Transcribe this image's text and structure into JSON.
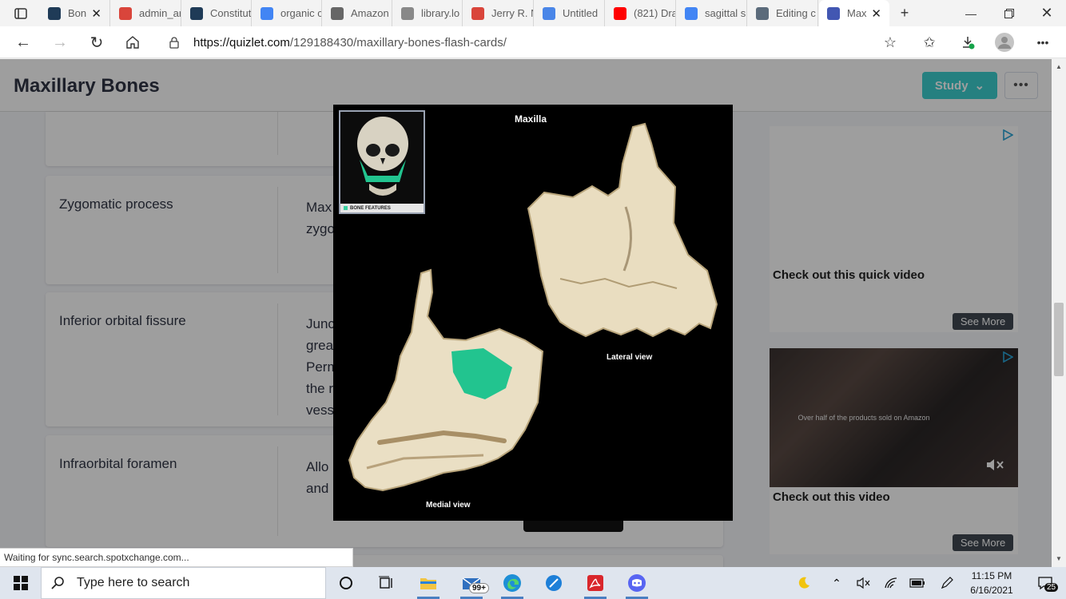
{
  "browser": {
    "tabs": [
      {
        "label": "Bon",
        "icon": "quizlet-dark-icon",
        "color": "#1f3b57"
      },
      {
        "label": "admin_ar",
        "icon": "pdf-icon",
        "color": "#d9453b"
      },
      {
        "label": "Constitut",
        "icon": "quizlet-dark-icon",
        "color": "#1f3b57"
      },
      {
        "label": "organic c",
        "icon": "google-icon",
        "color": "#4285f4"
      },
      {
        "label": "Amazon",
        "icon": "amazon-icon",
        "color": "#666666"
      },
      {
        "label": "library.lo",
        "icon": "document-icon",
        "color": "#888888"
      },
      {
        "label": "Jerry R. N",
        "icon": "pdf-icon",
        "color": "#d9453b"
      },
      {
        "label": "Untitled",
        "icon": "google-docs-icon",
        "color": "#4a86e8"
      },
      {
        "label": "(821) Dra",
        "icon": "youtube-icon",
        "color": "#ff0000"
      },
      {
        "label": "sagittal s",
        "icon": "google-icon",
        "color": "#4285f4"
      },
      {
        "label": "Editing c",
        "icon": "puzzle-icon",
        "color": "#5b6b7b"
      },
      {
        "label": "Max",
        "icon": "quizlet-icon",
        "color": "#4257b2"
      }
    ],
    "url_host": "https://quizlet.com",
    "url_path": "/129188430/maxillary-bones-flash-cards/"
  },
  "page": {
    "title": "Maxillary Bones",
    "study_label": "Study",
    "more_label": "•••",
    "cards": [
      {
        "term": "",
        "def_lines": []
      },
      {
        "term": "Zygomatic process",
        "def_lines": [
          "Max",
          "zygo"
        ]
      },
      {
        "term": "Inferior orbital fissure",
        "def_lines": [
          "Junc",
          "grea",
          "Perm",
          "the r",
          "vess"
        ]
      },
      {
        "term": "Infraorbital foramen",
        "def_lines": [
          "Allo",
          "and"
        ]
      }
    ]
  },
  "modal": {
    "title": "Maxilla",
    "thumb_label": "BONE FEATURES",
    "lateral_label": "Lateral view",
    "medial_label": "Medial view",
    "highlight_color": "#22c48f"
  },
  "ads": [
    {
      "label": "Check out this quick video",
      "see_more": "See More"
    },
    {
      "label": "Check out this video",
      "see_more": "See More",
      "video_caption": "Over half of the products sold on Amazon"
    }
  ],
  "status_text": "Waiting for sync.search.spotxchange.com...",
  "taskbar": {
    "search_placeholder": "Type here to search",
    "mail_badge": "99+",
    "time": "11:15 PM",
    "date": "6/16/2021",
    "notif_count": "25"
  }
}
